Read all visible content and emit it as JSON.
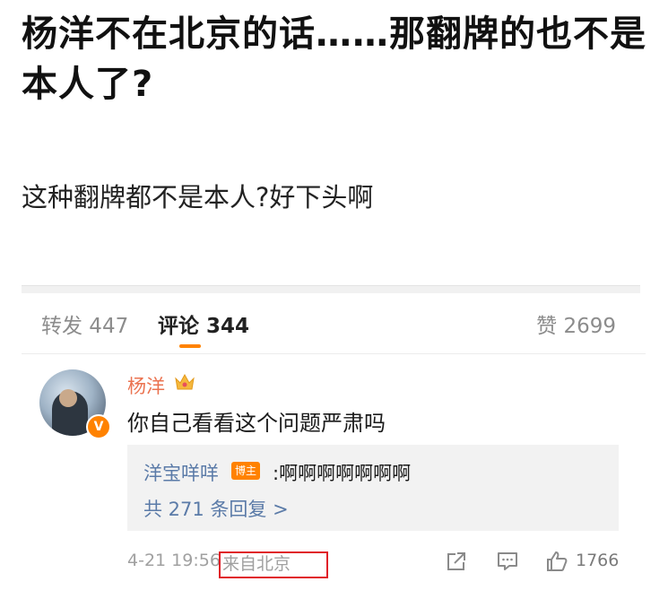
{
  "post": {
    "title": "杨洋不在北京的话……那翻牌的也不是本人了?",
    "body": "这种翻牌都不是本人?好下头啊"
  },
  "tabs": {
    "repost": "转发 447",
    "comment": "评论 344",
    "like": "赞 2699"
  },
  "comment": {
    "user": "杨洋",
    "verified_mark": "V",
    "text": "你自己看看这个问题严肃吗",
    "reply": {
      "user": "洋宝咩咩",
      "badge": "博主",
      "text": ":啊啊啊啊啊啊啊",
      "more": "共 271 条回复 >"
    },
    "time": "4-21 19:56",
    "location": "来自北京",
    "likes": "1766"
  },
  "colors": {
    "accent": "#ff8200",
    "username": "#eb7350",
    "link": "#5b7ba8",
    "highlight": "#e01e28"
  },
  "icons": [
    "crown-icon",
    "share-icon",
    "comment-icon",
    "like-icon",
    "verified-icon"
  ]
}
